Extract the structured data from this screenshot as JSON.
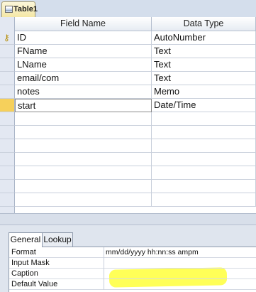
{
  "window": {
    "tab_title": "Table1",
    "tab_icon": "table-icon"
  },
  "grid": {
    "headers": [
      "Field Name",
      "Data Type"
    ],
    "rows": [
      {
        "field": "ID",
        "type": "AutoNumber",
        "primary_key": true
      },
      {
        "field": "FName",
        "type": "Text"
      },
      {
        "field": "LName",
        "type": "Text"
      },
      {
        "field": "email/com",
        "type": "Text"
      },
      {
        "field": "notes",
        "type": "Memo"
      },
      {
        "field": "start",
        "type": "Date/Time",
        "selected": true
      }
    ]
  },
  "properties": {
    "tabs": [
      "General",
      "Lookup"
    ],
    "active_tab": "General",
    "rows": [
      {
        "label": "Format",
        "value": "mm/dd/yyyy hh:nn:ss ampm"
      },
      {
        "label": "Input Mask",
        "value": ""
      },
      {
        "label": "Caption",
        "value": ""
      },
      {
        "label": "Default Value",
        "value": ""
      }
    ]
  },
  "colors": {
    "selected_row_marker": "#f6d05b",
    "highlight": "#ffff3a"
  }
}
